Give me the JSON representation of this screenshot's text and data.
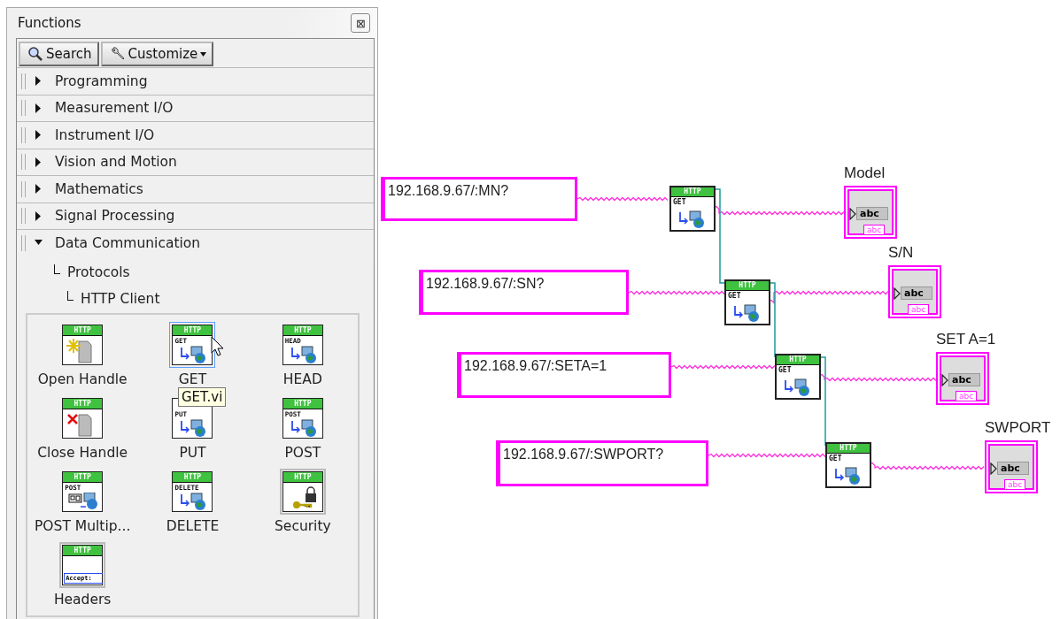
{
  "palette": {
    "title": "Functions",
    "close_glyph": "⊠",
    "toolbar": [
      {
        "label": "Search",
        "kind": "search"
      },
      {
        "label": "Customize",
        "kind": "customize"
      }
    ],
    "categories": [
      {
        "label": "Programming",
        "expanded": false
      },
      {
        "label": "Measurement I/O",
        "expanded": false
      },
      {
        "label": "Instrument I/O",
        "expanded": false
      },
      {
        "label": "Vision and Motion",
        "expanded": false
      },
      {
        "label": "Mathematics",
        "expanded": false
      },
      {
        "label": "Signal Processing",
        "expanded": false
      },
      {
        "label": "Data Communication",
        "expanded": true,
        "children": [
          {
            "label": "Protocols",
            "children": [
              {
                "label": "HTTP Client"
              }
            ]
          }
        ]
      }
    ],
    "items": [
      {
        "label": "Open Handle",
        "kind": "open",
        "banner": "HTTP",
        "selected": false
      },
      {
        "label": "GET",
        "kind": "method",
        "banner": "HTTP",
        "verb": "GET",
        "selected": true
      },
      {
        "label": "HEAD",
        "kind": "method",
        "banner": "HTTP",
        "verb": "HEAD",
        "selected": false
      },
      {
        "label": "Close Handle",
        "kind": "close",
        "banner": "HTTP",
        "selected": false
      },
      {
        "label": "PUT",
        "kind": "method",
        "verb": "PUT",
        "selected": false
      },
      {
        "label": "POST",
        "kind": "method",
        "banner": "HTTP",
        "verb": "POST",
        "selected": false
      },
      {
        "label": "POST Multip...",
        "kind": "multipart",
        "banner": "HTTP",
        "verb": "POST",
        "selected": false
      },
      {
        "label": "DELETE",
        "kind": "method",
        "banner": "HTTP",
        "verb": "DELETE",
        "selected": false
      },
      {
        "label": "Security",
        "kind": "security",
        "banner": "HTTP",
        "selected": false
      },
      {
        "label": "Headers",
        "kind": "headers",
        "banner": "HTTP",
        "field": "Accept:",
        "selected": false
      }
    ],
    "tooltip": "GET.vi"
  },
  "diagram": {
    "rows": [
      {
        "constant": "192.168.9.67/:MN?",
        "node": {
          "banner": "HTTP",
          "verb": "GET"
        },
        "indicator": {
          "label": "Model",
          "value": "abc",
          "type": "abc"
        }
      },
      {
        "constant": "192.168.9.67/:SN?",
        "node": {
          "banner": "HTTP",
          "verb": "GET"
        },
        "indicator": {
          "label": "S/N",
          "value": "abc",
          "type": "abc"
        }
      },
      {
        "constant": "192.168.9.67/:SETA=1",
        "node": {
          "banner": "HTTP",
          "verb": "GET"
        },
        "indicator": {
          "label": "SET A=1",
          "value": "abc",
          "type": "abc"
        }
      },
      {
        "constant": "192.168.9.67/:SWPORT?",
        "node": {
          "banner": "HTTP",
          "verb": "GET"
        },
        "indicator": {
          "label": "SWPORT",
          "value": "abc",
          "type": "abc"
        }
      }
    ]
  }
}
